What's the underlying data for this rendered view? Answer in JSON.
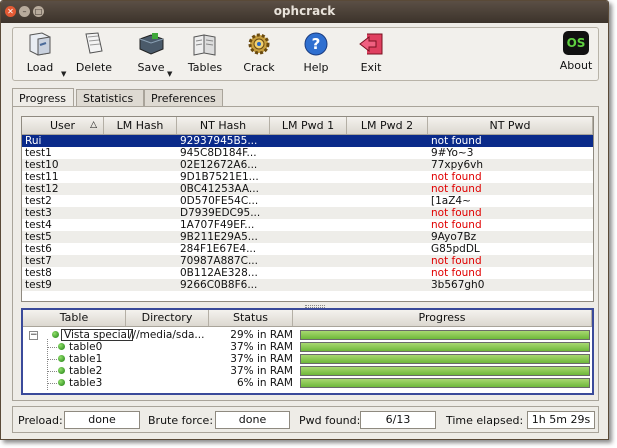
{
  "window": {
    "title": "ophcrack"
  },
  "toolbar": {
    "load": "Load",
    "delete": "Delete",
    "save": "Save",
    "tables": "Tables",
    "crack": "Crack",
    "help": "Help",
    "exit": "Exit",
    "about": "About",
    "about_logo": "OS"
  },
  "tabs": {
    "progress": "Progress",
    "statistics": "Statistics",
    "preferences": "Preferences"
  },
  "users": {
    "columns": [
      "User",
      "LM Hash",
      "NT Hash",
      "LM Pwd 1",
      "LM Pwd 2",
      "NT Pwd"
    ],
    "sort_indicator": "△",
    "rows": [
      {
        "user": "Rui",
        "nt_hash": "92937945B5...",
        "nt_pwd": "not found"
      },
      {
        "user": "test1",
        "nt_hash": "945C8D184F...",
        "nt_pwd": "9#Yo~3"
      },
      {
        "user": "test10",
        "nt_hash": "02E12672A6...",
        "nt_pwd": "77xpy6vh"
      },
      {
        "user": "test11",
        "nt_hash": "9D1B7521E1...",
        "nt_pwd": "not found"
      },
      {
        "user": "test12",
        "nt_hash": "0BC41253AA...",
        "nt_pwd": "not found"
      },
      {
        "user": "test2",
        "nt_hash": "0D570FE54C...",
        "nt_pwd": "[1aZ4~"
      },
      {
        "user": "test3",
        "nt_hash": "D7939EDC95...",
        "nt_pwd": "not found"
      },
      {
        "user": "test4",
        "nt_hash": "1A707F49EF...",
        "nt_pwd": "not found"
      },
      {
        "user": "test5",
        "nt_hash": "9B211E29A5...",
        "nt_pwd": "9Ayo7Bz"
      },
      {
        "user": "test6",
        "nt_hash": "284F1E67E4...",
        "nt_pwd": "G85pdDL"
      },
      {
        "user": "test7",
        "nt_hash": "70987A887C...",
        "nt_pwd": "not found"
      },
      {
        "user": "test8",
        "nt_hash": "0B112AE328...",
        "nt_pwd": "not found"
      },
      {
        "user": "test9",
        "nt_hash": "9266C0B8F6...",
        "nt_pwd": "3b567gh0"
      }
    ]
  },
  "tables": {
    "columns": [
      "Table",
      "Directory",
      "Status",
      "Progress"
    ],
    "expander": "−",
    "rows": [
      {
        "name": "Vista special",
        "directory": "///media/sda...",
        "status": "29% in RAM",
        "progress": 1.0
      },
      {
        "name": "table0",
        "directory": "",
        "status": "37% in RAM",
        "progress": 1.0
      },
      {
        "name": "table1",
        "directory": "",
        "status": "37% in RAM",
        "progress": 1.0
      },
      {
        "name": "table2",
        "directory": "",
        "status": "37% in RAM",
        "progress": 1.0
      },
      {
        "name": "table3",
        "directory": "",
        "status": "6% in RAM",
        "progress": 1.0
      }
    ]
  },
  "status": {
    "preload_label": "Preload:",
    "preload_value": "done",
    "brute_label": "Brute force:",
    "brute_value": "done",
    "pwd_label": "Pwd found:",
    "pwd_value": "6/13",
    "time_label": "Time elapsed:",
    "time_value": "1h 5m 29s"
  },
  "colors": {
    "selection": "#0a2a8a",
    "not_found": "#e00000",
    "progress_fill": "#6eb83a"
  }
}
